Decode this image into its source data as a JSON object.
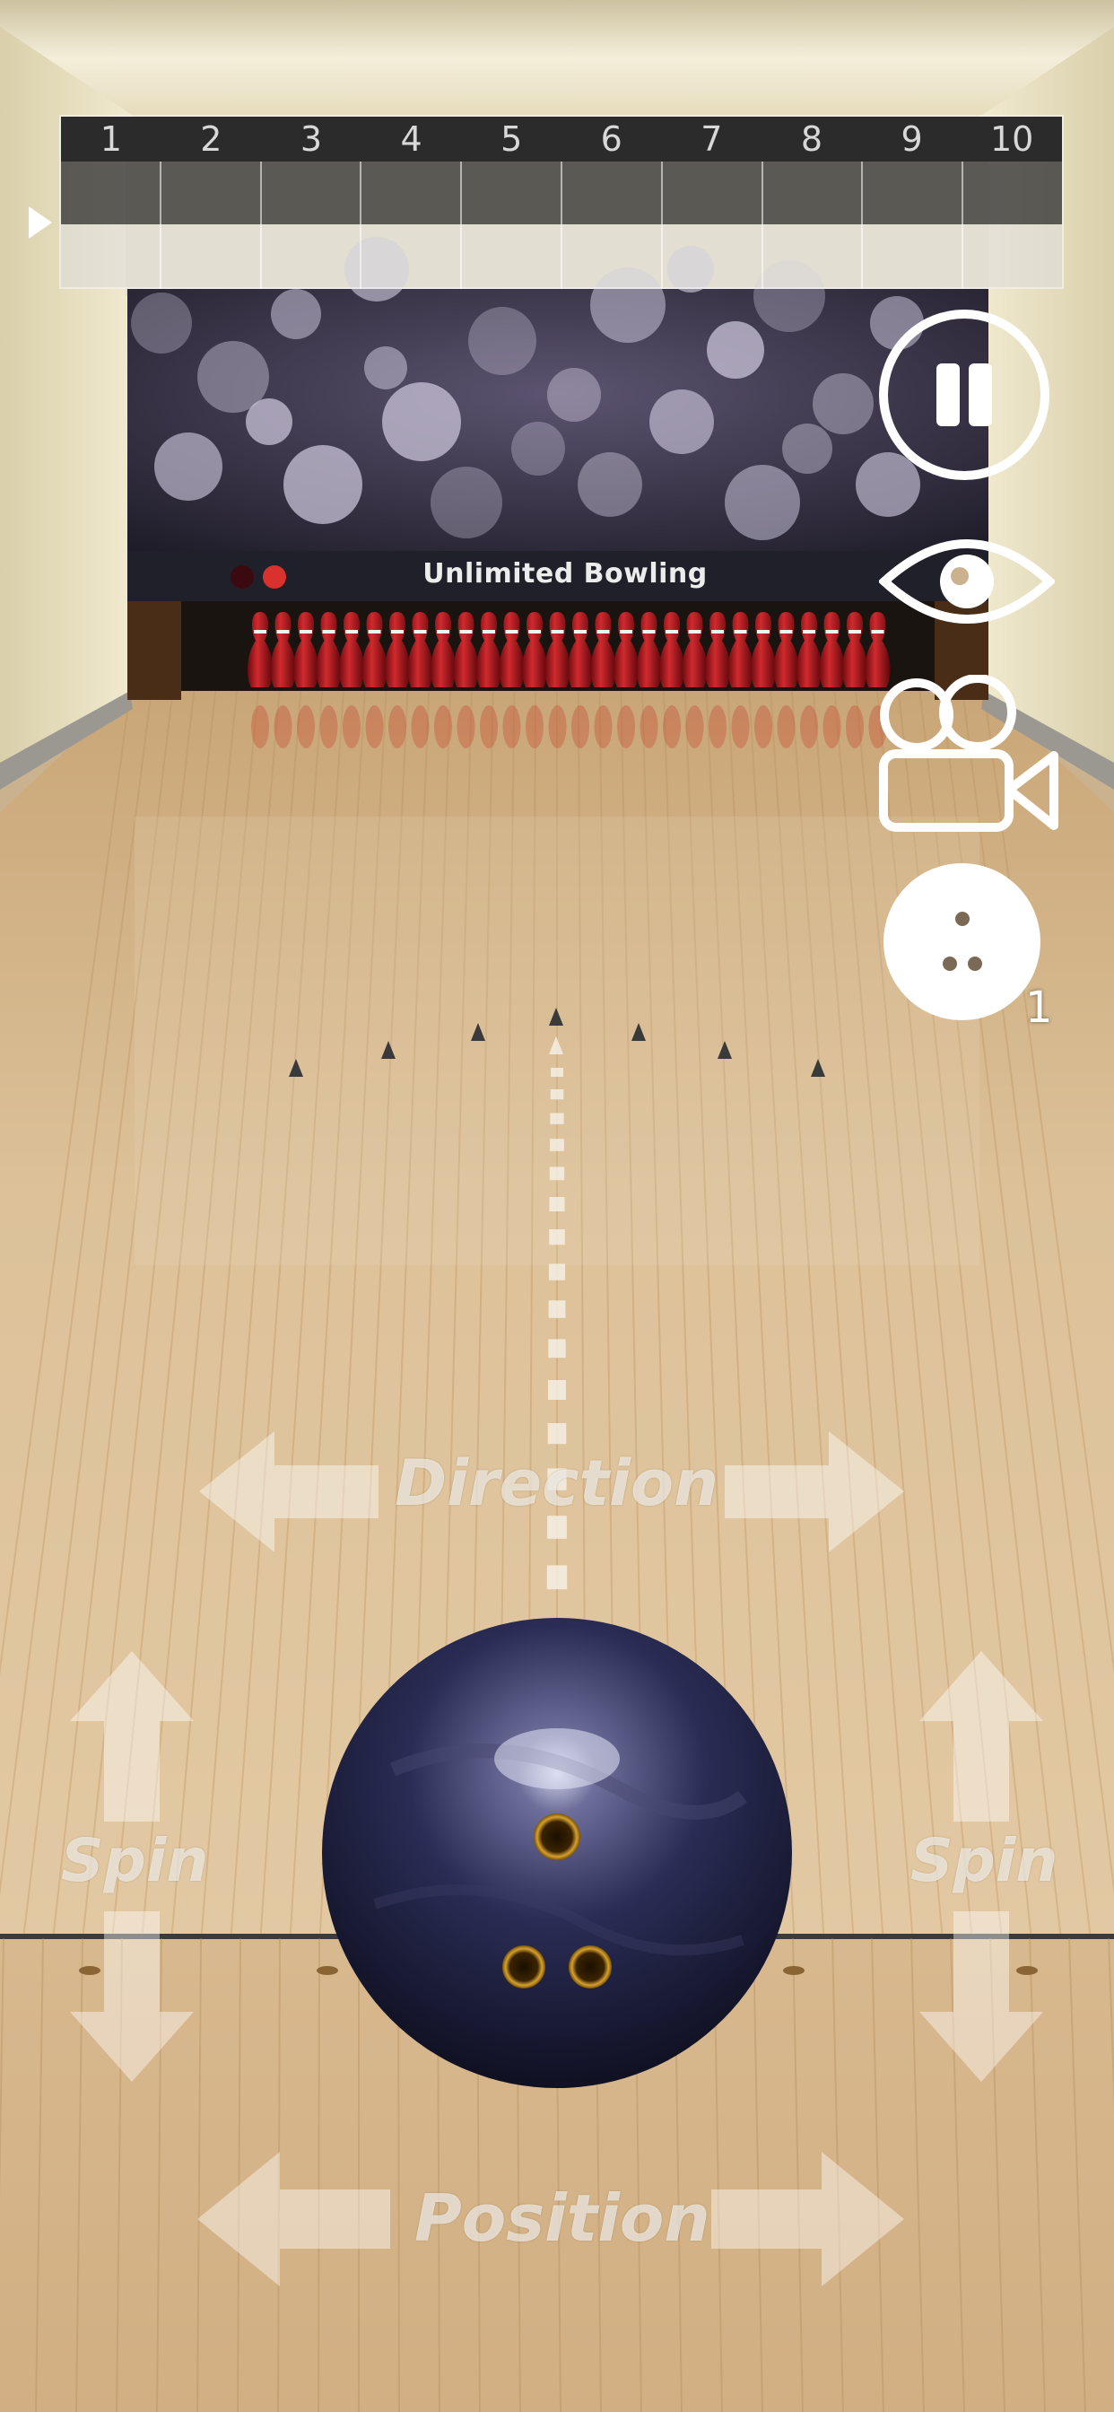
{
  "scoreboard": {
    "frames": [
      "1",
      "2",
      "3",
      "4",
      "5",
      "6",
      "7",
      "8",
      "9",
      "10"
    ],
    "rows": [
      [
        "",
        "",
        "",
        "",
        "",
        "",
        "",
        "",
        "",
        ""
      ],
      [
        "",
        "",
        "",
        "",
        "",
        "",
        "",
        "",
        "",
        ""
      ]
    ]
  },
  "marquee": {
    "title": "Unlimited Bowling"
  },
  "controls": {
    "pause": "pause",
    "view": "view",
    "camera": "camera",
    "ball_count": "1"
  },
  "labels": {
    "direction": "Direction",
    "position": "Position",
    "spin_left": "Spin",
    "spin_right": "Spin"
  },
  "icons": {
    "pause": "pause-icon",
    "view": "eye-icon",
    "camera": "video-camera-icon",
    "ball": "bowling-ball-icon"
  },
  "colors": {
    "lane_wood": "#d9bd95",
    "pin_red": "#b0141c",
    "ball_navy": "#1f2140",
    "scoreboard_header": "#2b2b2b"
  }
}
